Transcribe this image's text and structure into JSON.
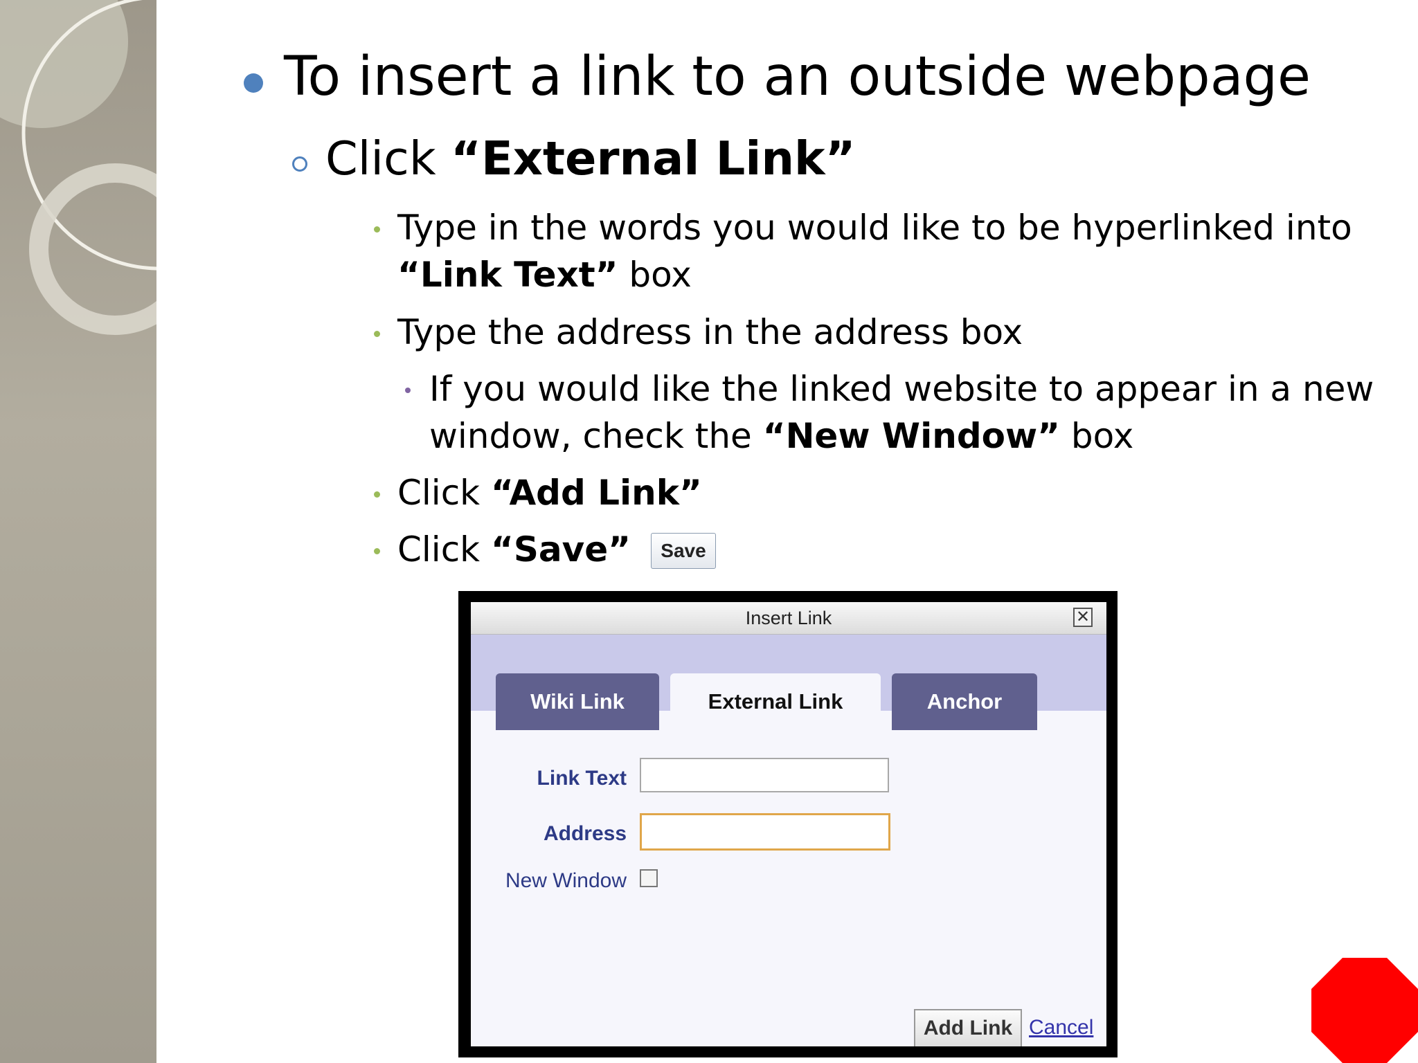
{
  "slide": {
    "bullet1": "To insert a link to an outside webpage",
    "bullet2": {
      "prefix": "Click ",
      "strong": "“External Link”"
    },
    "sub": [
      {
        "line1": "Type in the words you would like to be hyperlinked into",
        "line2_strong": "“Link Text”",
        "line2_rest": " box"
      },
      {
        "text": "Type the address in the address box"
      }
    ],
    "subsub": {
      "line1": "If you would like the linked website to appear in a new",
      "line2_prefix": "window, check the ",
      "line2_strong": "“New Window”",
      "line2_rest": " box"
    },
    "click_add": {
      "prefix": "Click ",
      "strong": "“Add Link”"
    },
    "click_save": {
      "prefix": "Click ",
      "strong": "“Save”"
    },
    "save_button_label": "Save"
  },
  "dialog": {
    "title": "Insert Link",
    "close_glyph": "✕",
    "tabs": [
      {
        "label": "Wiki Link",
        "active": false
      },
      {
        "label": "External Link",
        "active": true
      },
      {
        "label": "Anchor",
        "active": false
      }
    ],
    "fields": {
      "link_text_label": "Link Text",
      "link_text_value": "",
      "address_label": "Address",
      "address_value": "",
      "new_window_label": "New Window",
      "new_window_checked": false
    },
    "add_link_label": "Add Link",
    "cancel_label": "Cancel"
  },
  "colors": {
    "level1_bullet": "#4f81bd",
    "level3_bullet": "#9bbb59",
    "level4_bullet": "#8064a2",
    "tab_inactive": "#60608e",
    "tab_strip": "#c9c9ea",
    "stop_sign": "#ff0000"
  }
}
